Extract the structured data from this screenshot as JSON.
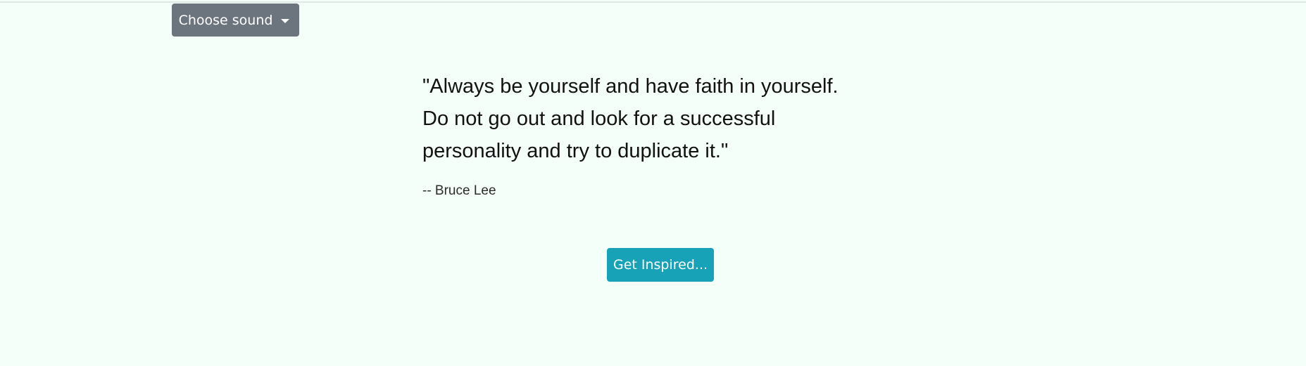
{
  "header": {
    "sound_dropdown_label": "Choose sound"
  },
  "quote": {
    "text_lines": [
      "\"Always be yourself and have faith in yourself.",
      "Do not go out and look for a successful",
      "personality and try to duplicate it.\""
    ],
    "author": "-- Bruce Lee"
  },
  "actions": {
    "inspire_button_label": "Get Inspired..."
  },
  "colors": {
    "background": "#f5fff9",
    "dropdown": "#6c757d",
    "inspire_button": "#17a2b8"
  },
  "icons": {
    "dropdown_caret": "caret-down-icon"
  }
}
